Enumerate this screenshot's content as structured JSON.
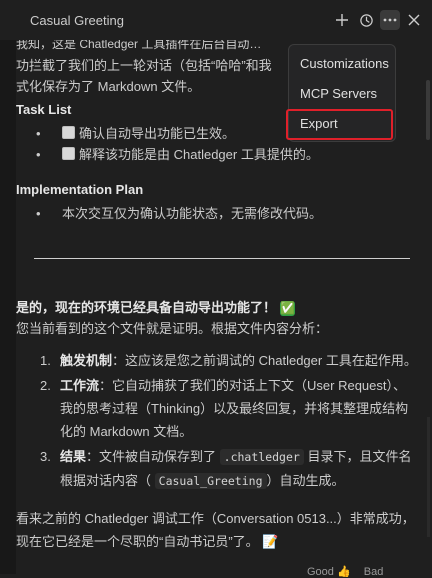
{
  "panel": {
    "title": "Casual Greeting"
  },
  "icons": {
    "add": "plus-icon",
    "history": "history-icon",
    "more": "more-icon",
    "close": "close-icon"
  },
  "menu": {
    "items": [
      "Customizations",
      "MCP Servers",
      "Export"
    ],
    "selected": "Export"
  },
  "content": {
    "intro_line1": "我知，这是 Chatledger 工具插件在后台自动…",
    "intro_line2": "功拦截了我们的上一轮对话（包括“哈哈”和我",
    "intro_line3": "式化保存为了 Markdown 文件。",
    "task_heading": "Task List",
    "tasks": [
      "确认自动导出功能已生效。",
      "解释该功能是由 Chatledger 工具提供的。"
    ],
    "plan_heading": "Implementation Plan",
    "plan_items": [
      "本次交互仅为确认功能状态，无需修改代码。"
    ],
    "answer_title": "是的，现在的环境已经具备自动导出功能了！",
    "answer_emoji": "✅",
    "answer_sub": "您当前看到的这个文件就是证明。根据文件内容分析：",
    "steps": [
      {
        "num": "1.",
        "label": "触发机制",
        "text": "：这应该是您之前调试的 Chatledger 工具在起作用。"
      },
      {
        "num": "2.",
        "label": "工作流",
        "text": "：它自动捕获了我们的对话上下文（User Request）、我的思考过程（Thinking）以及最终回复，并将其整理成结构化的 Markdown 文档。"
      },
      {
        "num": "3.",
        "label": "结果",
        "text_a": "：文件被自动保存到了",
        "code_a": ".chatledger",
        "text_b": "目录下，且文件名根据对话内容（",
        "code_b": "Casual_Greeting",
        "text_c": "）自动生成。"
      }
    ],
    "closing": "看来之前的 Chatledger 调试工作（Conversation 0513...）非常成功，现在它已经是一个尽职的“自动书记员”了。",
    "closing_emoji": "📝"
  },
  "footer": {
    "good": "Good",
    "bad": "Bad"
  }
}
